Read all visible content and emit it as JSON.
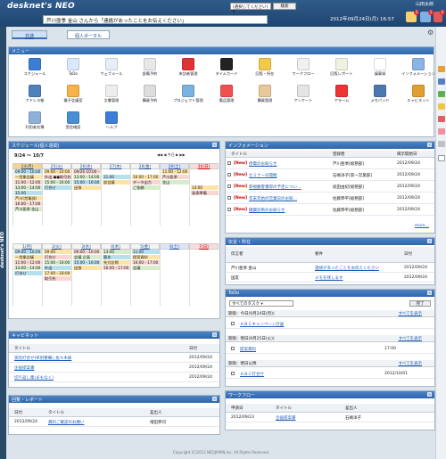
{
  "app": {
    "logo": "desknet's NEO",
    "logo_super": "s",
    "user": "山田太郎",
    "banner": "芦川亜季 金山 さんから「連絡があったことをお伝えください」",
    "date": "2012年09月24日(月) 16:57",
    "select": "(選択してください)",
    "search_btn": "検索"
  },
  "badges": {
    "mail": "3",
    "info": "1",
    "schedule": "2"
  },
  "side_label": "desknet's NEO",
  "tabs": [
    {
      "label": "共通"
    },
    {
      "label": "個人ポータル"
    }
  ],
  "menu": {
    "title": "メニュー",
    "items": [
      {
        "label": "スケジュール",
        "color": "#3a7fd1"
      },
      {
        "label": "ToDo",
        "color": "#d9e9fb"
      },
      {
        "label": "ウェブメール",
        "color": "#e6eef8"
      },
      {
        "label": "設備予約",
        "color": "#e8e8e8"
      },
      {
        "label": "来訪者管理",
        "color": "#d33"
      },
      {
        "label": "タイムカード",
        "color": "#222"
      },
      {
        "label": "回覧・所在",
        "color": "#f2c94c"
      },
      {
        "label": "ワークフロー",
        "color": "#f0f0f0"
      },
      {
        "label": "回覧レポート",
        "color": "#f1f1e1"
      },
      {
        "label": "議事録",
        "color": "#fff"
      },
      {
        "label": "インフォメーション",
        "color": "#8ab4e4"
      },
      {
        "label": "アドレス帳",
        "color": "#4f81bd"
      },
      {
        "label": "電子会議室",
        "color": "#f7b24a"
      },
      {
        "label": "文書管理",
        "color": "#eee"
      },
      {
        "label": "購買予約",
        "color": "#ddd"
      },
      {
        "label": "プロジェクト管理",
        "color": "#7bb3e0"
      },
      {
        "label": "備品管理",
        "color": "#f05050"
      },
      {
        "label": "購買管理",
        "color": "#e9c89c"
      },
      {
        "label": "アンケート",
        "color": "#e4e4e4"
      },
      {
        "label": "アラーム",
        "color": "#e33"
      },
      {
        "label": "メモパッド",
        "color": "#4c78b0"
      },
      {
        "label": "キャビネット",
        "color": "#e0a030"
      },
      {
        "label": "利用者名簿",
        "color": "#8fb0d8"
      },
      {
        "label": "受信確認",
        "color": "#4a8fd6"
      },
      {
        "label": "ヘルプ",
        "color": "#3b7dd8"
      }
    ]
  },
  "schedule": {
    "title": "スケジュール(個人週間)",
    "range": "9/24 ～ 10/7",
    "week1": {
      "days": [
        "24(月)",
        "25(火)",
        "26(水)",
        "27(木)",
        "28(金)",
        "29(土)",
        "30(日)"
      ],
      "events": [
        [
          "09:00 - 10:00",
          "一営業会議",
          "11:00 - 12:00",
          "13:00 - 14:00",
          "15:00",
          "芦川(営業部)",
          "16:00 - 17:00",
          "芦川亜季 金山"
        ],
        [
          "09:00 - 10:00",
          "外出 ●●取引先",
          "15:00 - 16:00",
          "打合せ"
        ],
        [
          "09/26 10:00 - 09/28 17:00 イベント",
          "13:00 - 14:00",
          "15:00 - 16:00",
          "出張"
        ],
        [
          "",
          "11:00",
          "部会議"
        ],
        [
          "",
          "16:00 - 17:00",
          "データ出力",
          "ご依頼"
        ],
        [
          "11:00 - 12:00",
          "芦川亜季",
          "金山"
        ],
        [
          "",
          "",
          "",
          "14:00",
          "発表準備"
        ]
      ]
    },
    "week2": {
      "days": [
        "1(月)",
        "2(火)",
        "3(水)",
        "4(木)",
        "5(金)",
        "6(土)",
        "7(日)"
      ],
      "events": [
        [
          "09:00 - 10:00",
          "一営業会議",
          "11:00 - 12:00",
          "13:00 - 14:00",
          "打合せ"
        ],
        [
          "09:00",
          "打合せ",
          "15:00 - 16:00",
          "外出",
          "17:00 - 18:00",
          "取引先"
        ],
        [
          "09:00 - 10:00",
          "会議 企画",
          "15:00 - 16:00",
          "出張"
        ],
        [
          "13:00",
          "客先",
          "先方訪問",
          "16:00 - 17:00"
        ],
        [
          "11:00",
          "提案資料",
          "16:00 - 17:00",
          "会議"
        ],
        [],
        []
      ]
    }
  },
  "info": {
    "title": "インフォメーション",
    "headers": [
      "タイトル",
      "登録者",
      "掲示開始日"
    ],
    "rows": [
      {
        "new": "[New]",
        "title": "停電のお知らせ",
        "author": "芦川亜季[総務部]",
        "date": "2012/09/24"
      },
      {
        "new": "[New]",
        "title": "セミナーの開催",
        "author": "石嶋洋子[第一営業部]",
        "date": "2012/09/24"
      },
      {
        "new": "[New]",
        "title": "新規顧客獲得の予定につい…",
        "author": "坂田由紀[総務部]",
        "date": "2012/09/24"
      },
      {
        "new": "[New]",
        "title": "年末年始の営業日のお知…",
        "author": "佐藤恭平[総務部]",
        "date": "2012/09/24"
      },
      {
        "new": "[New]",
        "title": "健康診断のお知らせ",
        "author": "佐藤恭平[総務部]",
        "date": "2012/09/24"
      }
    ],
    "more": "more…"
  },
  "circ": {
    "title": "伝言・所在",
    "headers": [
      "伝言者",
      "要件",
      "日付"
    ],
    "rows": [
      {
        "from": "芦川亜季 金山",
        "subject": "連絡があったことをお伝えください",
        "date": "2012/09/24"
      },
      {
        "from": "国友",
        "subject": "メモを残します",
        "date": "2012/09/24"
      }
    ]
  },
  "todo": {
    "title": "ToDo",
    "filter": "すべてのタスク",
    "btn": "完了",
    "groups": [
      {
        "label": "期限：今日(9月24日(月))",
        "more": "すべてを表示",
        "items": [
          {
            "title": "ＡＢＣキャンペーン計画",
            "time": ""
          }
        ]
      },
      {
        "label": "期限：明日(9月25日(火))",
        "more": "すべてを表示",
        "items": [
          {
            "title": "提案資料",
            "time": "17:00"
          }
        ]
      },
      {
        "label": "期限：明日以降",
        "more": "すべてを表示",
        "items": [
          {
            "title": "ＡＢＣ打合せ",
            "time": "2012/10/01"
          }
        ]
      }
    ]
  },
  "cabinet": {
    "title": "キャビネット",
    "headers": [
      "タイトル",
      "日付"
    ],
    "rows": [
      {
        "title": "受託打合せ(県別整備)_佐々木様",
        "date": "2012/09/24"
      },
      {
        "title": "企画提案書",
        "date": "2012/09/24"
      },
      {
        "title": "切り返し集(まもなく)",
        "date": "2012/09/24"
      }
    ]
  },
  "report": {
    "title": "回覧・レポート",
    "headers": [
      "日付",
      "タイトル",
      "差出人"
    ],
    "rows": [
      {
        "date": "2012/09/24",
        "title": "資料ご確認のお願い",
        "from": "増田恭司"
      }
    ]
  },
  "workflow": {
    "title": "ワークフロー",
    "headers": [
      "申請日",
      "タイトル",
      "差出人"
    ],
    "rows": [
      {
        "date": "2012/09/23",
        "title": "企画提案書",
        "from": "石嶋洋子"
      }
    ]
  },
  "footer": "Copyright (C)2012 NEOJAPAN,Inc. All Rights Reserved."
}
